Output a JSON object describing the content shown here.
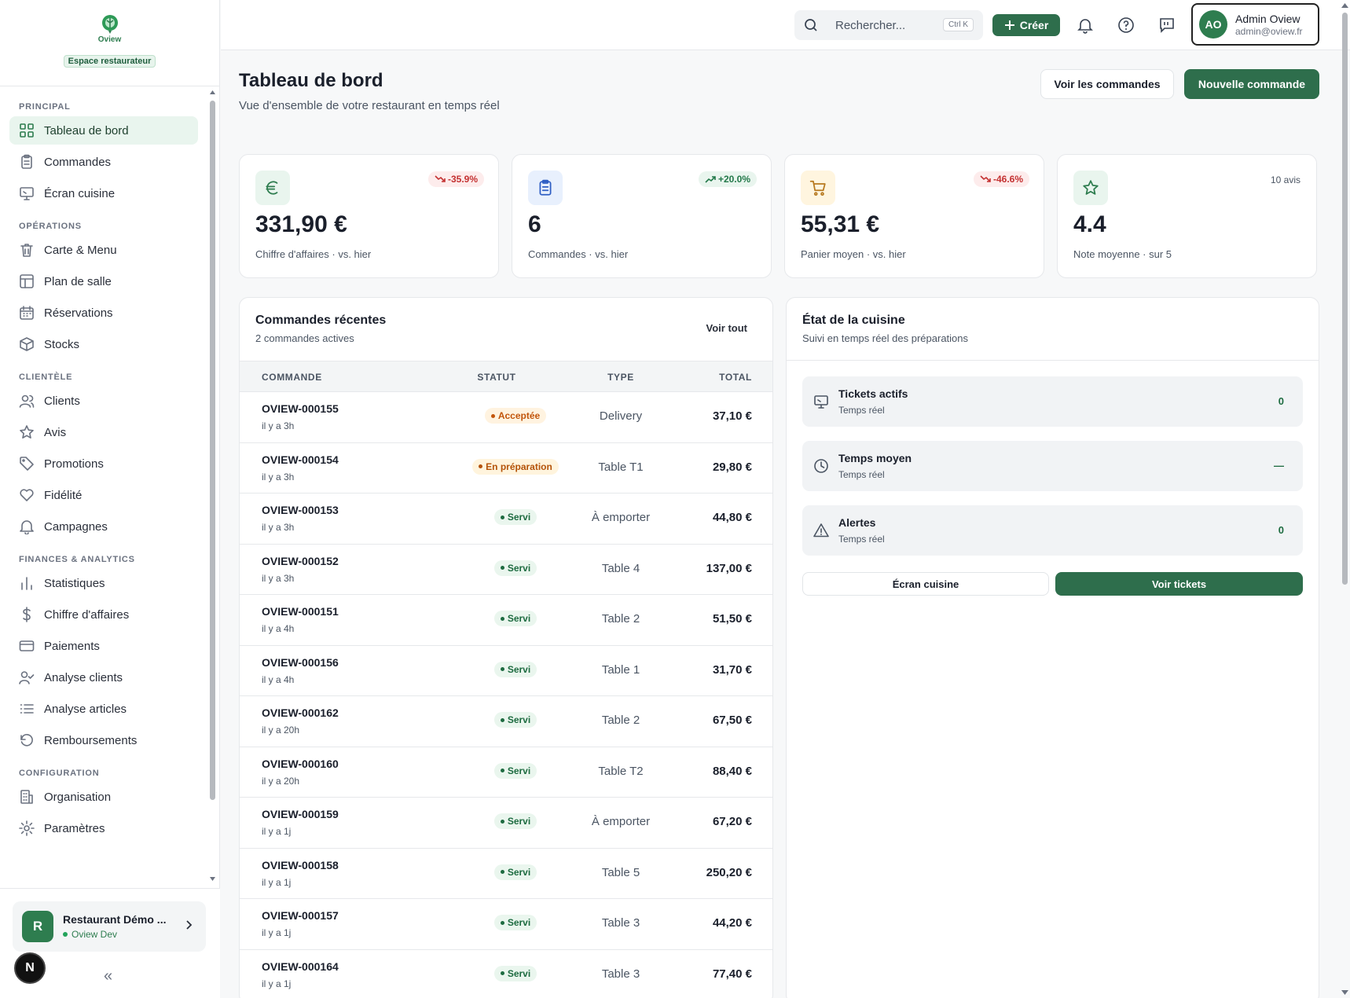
{
  "app": {
    "logo_text": "Oview",
    "space_badge": "Espace restaurateur"
  },
  "sidebar": {
    "sections": [
      {
        "title": "PRINCIPAL",
        "items": [
          {
            "label": "Tableau de bord",
            "icon": "grid-icon",
            "active": true
          },
          {
            "label": "Commandes",
            "icon": "clipboard-icon"
          },
          {
            "label": "Écran cuisine",
            "icon": "monitor-icon"
          }
        ]
      },
      {
        "title": "OPÉRATIONS",
        "items": [
          {
            "label": "Carte & Menu",
            "icon": "trash-icon"
          },
          {
            "label": "Plan de salle",
            "icon": "layout-icon"
          },
          {
            "label": "Réservations",
            "icon": "calendar-icon"
          },
          {
            "label": "Stocks",
            "icon": "box-icon"
          }
        ]
      },
      {
        "title": "CLIENTÈLE",
        "items": [
          {
            "label": "Clients",
            "icon": "users-icon"
          },
          {
            "label": "Avis",
            "icon": "star-icon"
          },
          {
            "label": "Promotions",
            "icon": "tag-icon"
          },
          {
            "label": "Fidélité",
            "icon": "heart-icon"
          },
          {
            "label": "Campagnes",
            "icon": "bell-icon"
          }
        ]
      },
      {
        "title": "FINANCES & ANALYTICS",
        "items": [
          {
            "label": "Statistiques",
            "icon": "bar-chart-icon"
          },
          {
            "label": "Chiffre d'affaires",
            "icon": "dollar-icon"
          },
          {
            "label": "Paiements",
            "icon": "credit-card-icon"
          },
          {
            "label": "Analyse clients",
            "icon": "user-check-icon"
          },
          {
            "label": "Analyse articles",
            "icon": "list-icon"
          },
          {
            "label": "Remboursements",
            "icon": "rotate-ccw-icon"
          }
        ]
      },
      {
        "title": "CONFIGURATION",
        "items": [
          {
            "label": "Organisation",
            "icon": "building-icon"
          },
          {
            "label": "Paramètres",
            "icon": "settings-icon"
          }
        ]
      }
    ],
    "restaurant": {
      "avatar": "R",
      "name": "Restaurant Démo ...",
      "sub": "Oview Dev"
    },
    "collapse": "«",
    "dev_badge": "N"
  },
  "topbar": {
    "search_placeholder": "Rechercher...",
    "search_shortcut": "Ctrl K",
    "create_label": "Créer",
    "user": {
      "initials": "AO",
      "name": "Admin Oview",
      "email": "admin@oview.fr"
    }
  },
  "header": {
    "title": "Tableau de bord",
    "subtitle": "Vue d'ensemble de votre restaurant en temps réel",
    "btn_orders": "Voir les commandes",
    "btn_new": "Nouvelle commande"
  },
  "stats": [
    {
      "icon": "euro-icon",
      "value": "331,90 €",
      "label": "Chiffre d'affaires · vs. hier",
      "trend": "-35.9%",
      "trend_dir": "down"
    },
    {
      "icon": "clipboard-icon",
      "value": "6",
      "label": "Commandes · vs. hier",
      "trend": "+20.0%",
      "trend_dir": "up"
    },
    {
      "icon": "cart-icon",
      "value": "55,31 €",
      "label": "Panier moyen · vs. hier",
      "trend": "-46.6%",
      "trend_dir": "down"
    },
    {
      "icon": "star-icon",
      "value": "4.4",
      "label": "Note moyenne · sur 5",
      "count": "10 avis"
    }
  ],
  "orders": {
    "title": "Commandes récentes",
    "subtitle": "2 commandes actives",
    "see_all": "Voir tout",
    "columns": [
      "COMMANDE",
      "STATUT",
      "TYPE",
      "TOTAL"
    ],
    "rows": [
      {
        "id": "OVIEW-000155",
        "time": "il y a 3h",
        "status": "Acceptée",
        "status_kind": "accepted",
        "type": "Delivery",
        "total": "37,10 €"
      },
      {
        "id": "OVIEW-000154",
        "time": "il y a 3h",
        "status": "En préparation",
        "status_kind": "prep",
        "type": "Table T1",
        "total": "29,80 €"
      },
      {
        "id": "OVIEW-000153",
        "time": "il y a 3h",
        "status": "Servi",
        "status_kind": "served",
        "type": "À emporter",
        "total": "44,80 €"
      },
      {
        "id": "OVIEW-000152",
        "time": "il y a 3h",
        "status": "Servi",
        "status_kind": "served",
        "type": "Table 4",
        "total": "137,00 €"
      },
      {
        "id": "OVIEW-000151",
        "time": "il y a 4h",
        "status": "Servi",
        "status_kind": "served",
        "type": "Table 2",
        "total": "51,50 €"
      },
      {
        "id": "OVIEW-000156",
        "time": "il y a 4h",
        "status": "Servi",
        "status_kind": "served",
        "type": "Table 1",
        "total": "31,70 €"
      },
      {
        "id": "OVIEW-000162",
        "time": "il y a 20h",
        "status": "Servi",
        "status_kind": "served",
        "type": "Table 2",
        "total": "67,50 €"
      },
      {
        "id": "OVIEW-000160",
        "time": "il y a 20h",
        "status": "Servi",
        "status_kind": "served",
        "type": "Table T2",
        "total": "88,40 €"
      },
      {
        "id": "OVIEW-000159",
        "time": "il y a 1j",
        "status": "Servi",
        "status_kind": "served",
        "type": "À emporter",
        "total": "67,20 €"
      },
      {
        "id": "OVIEW-000158",
        "time": "il y a 1j",
        "status": "Servi",
        "status_kind": "served",
        "type": "Table 5",
        "total": "250,20 €"
      },
      {
        "id": "OVIEW-000157",
        "time": "il y a 1j",
        "status": "Servi",
        "status_kind": "served",
        "type": "Table 3",
        "total": "44,20 €"
      },
      {
        "id": "OVIEW-000164",
        "time": "il y a 1j",
        "status": "Servi",
        "status_kind": "served",
        "type": "Table 3",
        "total": "77,40 €"
      }
    ]
  },
  "kitchen": {
    "title": "État de la cuisine",
    "subtitle": "Suivi en temps réel des préparations",
    "items": [
      {
        "icon": "monitor-icon",
        "title": "Tickets actifs",
        "sub": "Temps réel",
        "value": "0"
      },
      {
        "icon": "clock-icon",
        "title": "Temps moyen",
        "sub": "Temps réel",
        "value": "—"
      },
      {
        "icon": "alert-triangle-icon",
        "title": "Alertes",
        "sub": "Temps réel",
        "value": "0"
      }
    ],
    "btn_screen": "Écran cuisine",
    "btn_tickets": "Voir tickets"
  },
  "colors": {
    "brand": "#2e6e4c",
    "accent": "#2e7d4f",
    "danger": "#c43131"
  }
}
